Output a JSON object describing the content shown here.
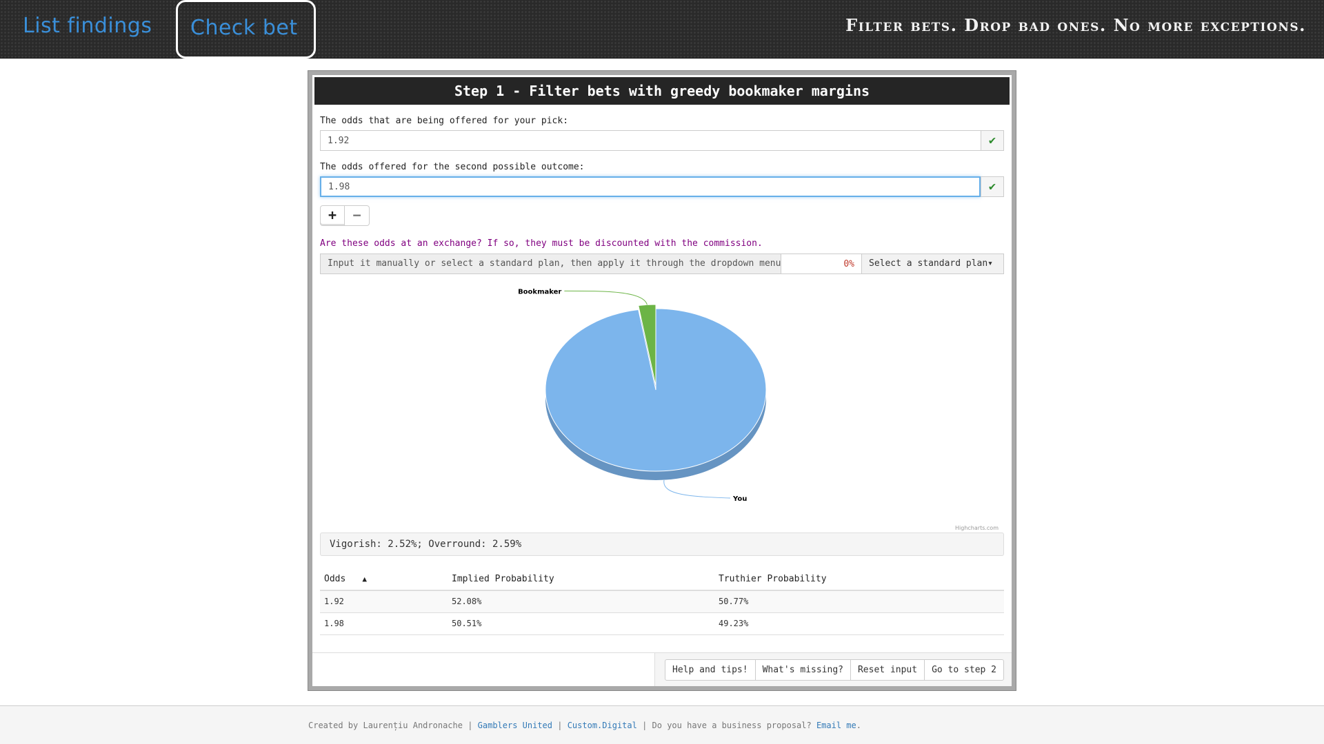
{
  "nav": {
    "list_findings": "List findings",
    "check_bet": "Check bet",
    "tagline": "Filter bets. Drop bad ones. No more exceptions."
  },
  "panel": {
    "title": "Step 1 - Filter bets with greedy bookmaker margins",
    "pick_label": "The odds that are being offered for your pick:",
    "pick_value": "1.92",
    "second_label": "The odds offered for the second possible outcome:",
    "second_value": "1.98",
    "plus": "+",
    "minus": "−",
    "exchange_question": "Are these odds at an exchange? If so, they must be discounted with the commission.",
    "commission_label": "Input it manually or select a standard plan, then apply it through the dropdown menu:",
    "commission_value": "0%",
    "standard_plan": "Select a standard plan▾",
    "result": "Vigorish: 2.52%; Overround: 2.59%"
  },
  "chart_data": {
    "type": "pie",
    "slices": [
      {
        "name": "You",
        "value": 97.48,
        "color": "#7cb5ec"
      },
      {
        "name": "Bookmaker",
        "value": 2.52,
        "color": "#6cb446"
      }
    ],
    "credits": "Highcharts.com"
  },
  "table": {
    "headers": [
      "Odds",
      "Implied Probability",
      "Truthier Probability"
    ],
    "sort_indicator": "▲",
    "rows": [
      [
        "1.92",
        "52.08%",
        "50.77%"
      ],
      [
        "1.98",
        "50.51%",
        "49.23%"
      ]
    ]
  },
  "footer_buttons": {
    "help": "Help and tips!",
    "missing": "What's missing?",
    "reset": "Reset input",
    "step2": "Go to step 2"
  },
  "page_footer": {
    "created_by": "Created by Laurențiu Andronache | ",
    "gamblers": "Gamblers United",
    "sep1": " | ",
    "custom": "Custom.Digital",
    "proposal": " | Do you have a business proposal? ",
    "email": "Email me",
    "dot": "."
  },
  "colors": {
    "accent": "#3a8fd9",
    "header_bg": "#2a2a2a",
    "success": "#2e8b2e",
    "exchange_text": "#800080"
  }
}
